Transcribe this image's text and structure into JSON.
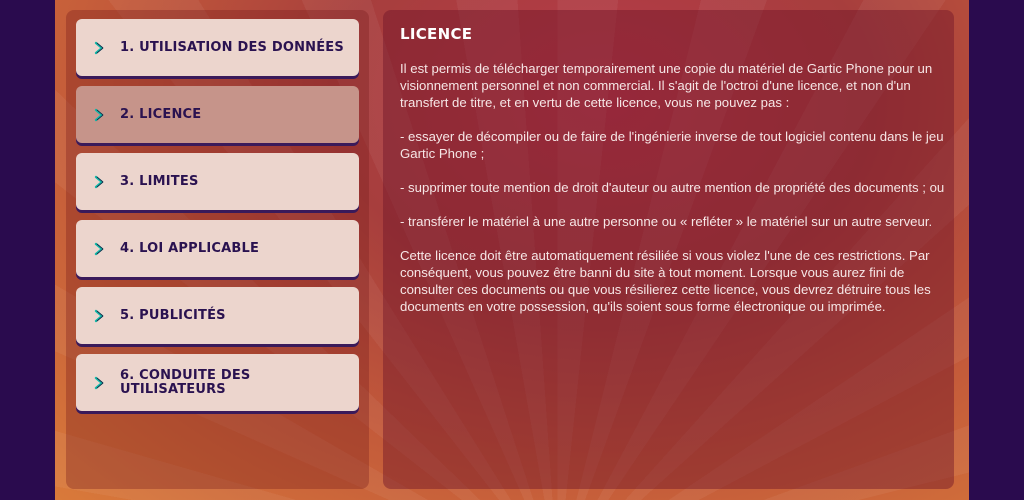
{
  "nav": {
    "items": [
      {
        "label": "1. UTILISATION DES DONNÉES"
      },
      {
        "label": "2. LICENCE"
      },
      {
        "label": "3. LIMITES"
      },
      {
        "label": "4. LOI APPLICABLE"
      },
      {
        "label": "5. PUBLICITÉS"
      },
      {
        "label": "6. CONDUITE DES\nUTILISATEURS"
      }
    ],
    "active_index": 1,
    "icon": "chevron-right-icon"
  },
  "content": {
    "title": "LICENCE",
    "paragraphs": [
      "Il est permis de télécharger temporairement une copie du matériel de Gartic Phone pour un visionnement personnel et non commercial. Il s'agit de l'octroi d'une licence, et non d'un transfert de titre, et en vertu de cette licence, vous ne pouvez pas :",
      "- essayer de décompiler ou de faire de l'ingénierie inverse de tout logiciel contenu dans le jeu Gartic Phone ;",
      "- supprimer toute mention de droit d'auteur ou autre mention de propriété des documents ; ou",
      "- transférer le matériel à une autre personne ou « refléter » le matériel sur un autre serveur.",
      "Cette licence doit être automatiquement résiliée si vous violez l'une de ces restrictions. Par conséquent, vous pouvez être banni du site à tout moment. Lorsque vous aurez fini de consulter ces documents ou que vous résilierez cette licence, vous devrez détruire tous les documents en votre possession, qu'ils soient sous forme électronique ou imprimée."
    ]
  },
  "colors": {
    "background": "#2a0b4e",
    "nav_item": "#ecd5cd",
    "nav_item_active": "#c6948a",
    "nav_text": "#2a1250",
    "chevron": "#0fb8a8",
    "content_text": "#f6e6e6"
  }
}
